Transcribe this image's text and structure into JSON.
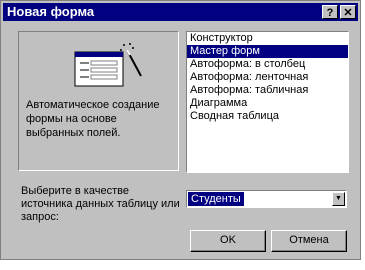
{
  "window": {
    "title": "Новая форма",
    "help_label": "?",
    "close_label": "✕"
  },
  "preview": {
    "description": "Автоматическое создание формы на основе выбранных полей."
  },
  "listbox": {
    "items": [
      "Конструктор",
      "Мастер форм",
      "Автоформа: в столбец",
      "Автоформа: ленточная",
      "Автоформа: табличная",
      "Диаграмма",
      "Сводная таблица"
    ],
    "selected": "Мастер форм"
  },
  "source": {
    "label": "Выберите в качестве источника данных таблицу или запрос:",
    "value": "Студенты",
    "arrow_icon": "chevron-down-icon"
  },
  "buttons": {
    "ok_label": "OK",
    "cancel_label": "Отмена"
  },
  "colors": {
    "title_bar": "#000080",
    "selection": "#000080",
    "face": "#c0c0c0"
  }
}
